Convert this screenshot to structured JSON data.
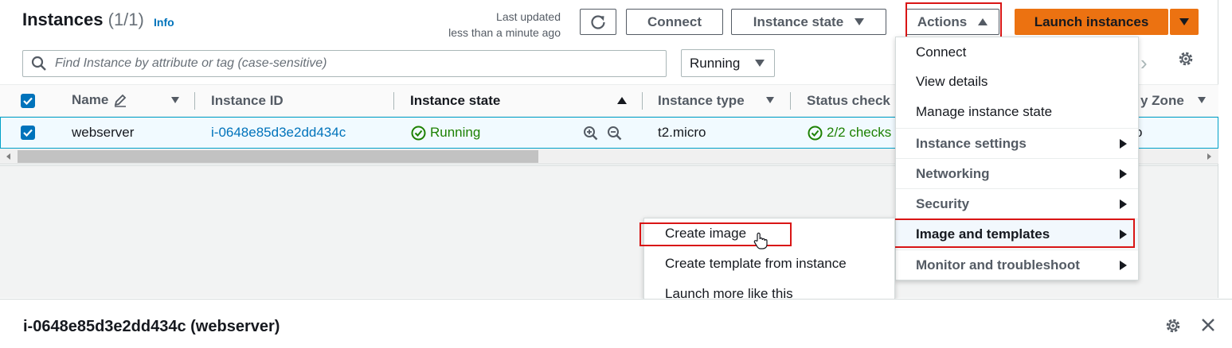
{
  "header": {
    "title": "Instances",
    "count": "(1/1)",
    "info": "Info",
    "last_updated_line1": "Last updated",
    "last_updated_line2": "less than a minute ago"
  },
  "toolbar": {
    "connect": "Connect",
    "instance_state": "Instance state",
    "actions": "Actions",
    "launch": "Launch instances"
  },
  "search": {
    "placeholder": "Find Instance by attribute or tag (case-sensitive)",
    "filter_value": "Running"
  },
  "table": {
    "columns": [
      "Name",
      "Instance ID",
      "Instance state",
      "Instance type",
      "Status check",
      "y Zone"
    ],
    "row": {
      "name": "webserver",
      "instance_id": "i-0648e85d3e2dd434c",
      "state": "Running",
      "type": "t2.micro",
      "status_check": "2/2 checks",
      "zone_partial": "o"
    }
  },
  "actions_menu": {
    "items": [
      {
        "label": "Connect"
      },
      {
        "label": "View details"
      },
      {
        "label": "Manage instance state"
      },
      {
        "label": "Instance settings"
      },
      {
        "label": "Networking"
      },
      {
        "label": "Security"
      },
      {
        "label": "Image and templates"
      },
      {
        "label": "Monitor and troubleshoot"
      }
    ]
  },
  "image_submenu": {
    "items": [
      {
        "label": "Create image"
      },
      {
        "label": "Create template from instance"
      },
      {
        "label": "Launch more like this"
      }
    ]
  },
  "details": {
    "title": "i-0648e85d3e2dd434c (webserver)"
  },
  "colors": {
    "primary": "#ec7211",
    "link": "#0073bb",
    "success": "#1d8102",
    "highlight": "#d91515"
  }
}
